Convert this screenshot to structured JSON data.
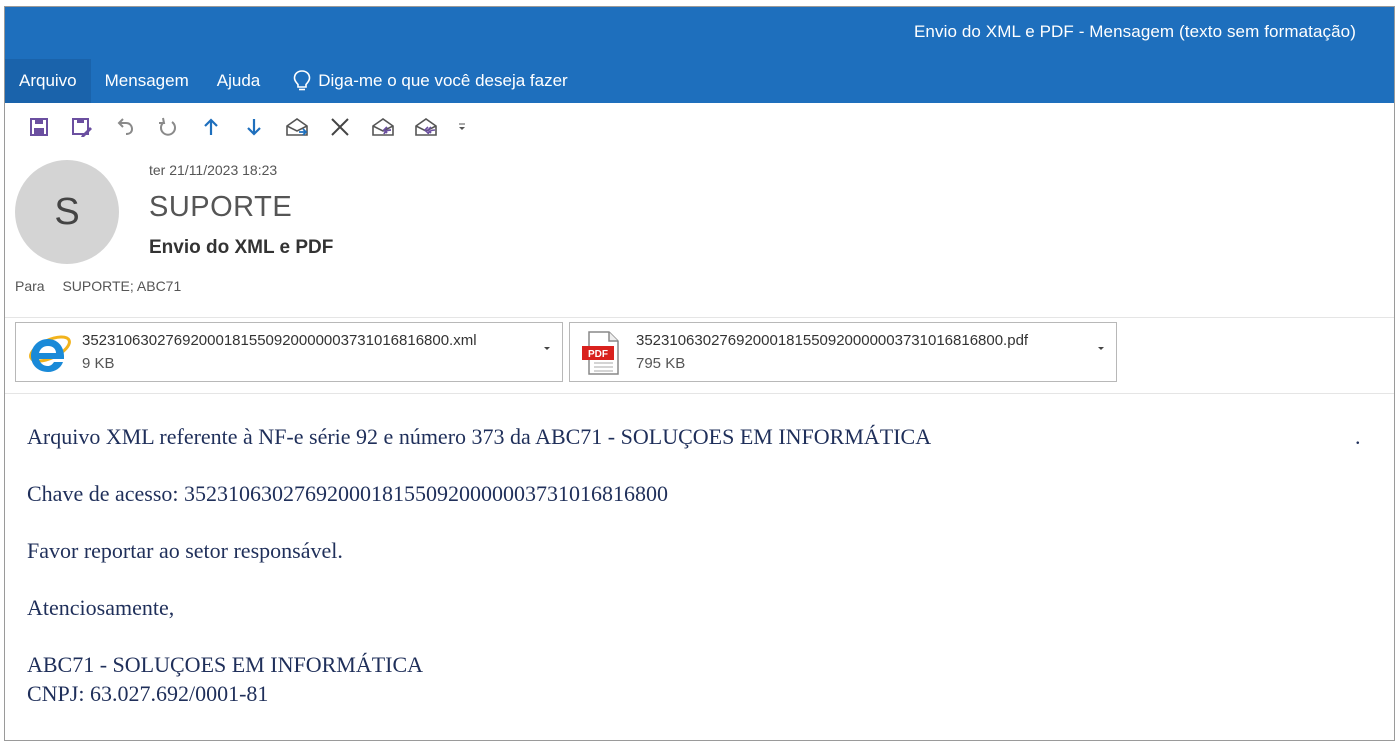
{
  "window": {
    "title": "Envio do XML e PDF  -  Mensagem (texto sem formatação)"
  },
  "menu": {
    "items": [
      "Arquivo",
      "Mensagem",
      "Ajuda"
    ],
    "tell_me": "Diga-me o que você deseja fazer"
  },
  "toolbar": {
    "icons": [
      "save-icon",
      "save-as-icon",
      "undo-icon",
      "redo-icon",
      "up-arrow-icon",
      "down-arrow-icon",
      "move-icon",
      "delete-icon",
      "reply-icon",
      "reply-all-icon",
      "customize-dropdown-icon"
    ]
  },
  "message": {
    "avatar_letter": "S",
    "date": "ter 21/11/2023 18:23",
    "sender": "SUPORTE",
    "subject": "Envio do XML e PDF",
    "to_label": "Para",
    "to_value": "SUPORTE; ABC71"
  },
  "attachments": [
    {
      "name": "35231063027692000181550920000003731016816800.xml",
      "size": "9 KB",
      "icon": "ie-icon"
    },
    {
      "name": "35231063027692000181550920000003731016816800.pdf",
      "size": "795 KB",
      "icon": "pdf-icon"
    }
  ],
  "body": {
    "line1": "Arquivo XML referente à NF-e série 92 e número 373 da ABC71 - SOLUÇOES EM INFORMÁTICA",
    "line1_trailing": ".",
    "line2": "Chave de acesso: 35231063027692000181550920000003731016816800",
    "line3": "Favor reportar ao setor responsável.",
    "line4": "Atenciosamente,",
    "line5": "ABC71 - SOLUÇOES EM INFORMÁTICA",
    "line6": "CNPJ: 63.027.692/0001-81"
  },
  "colors": {
    "titlebar": "#1e6fbd",
    "icon_purple": "#6b4fa0",
    "icon_blue": "#1e6fbd",
    "body_text": "#1f2f5a"
  }
}
